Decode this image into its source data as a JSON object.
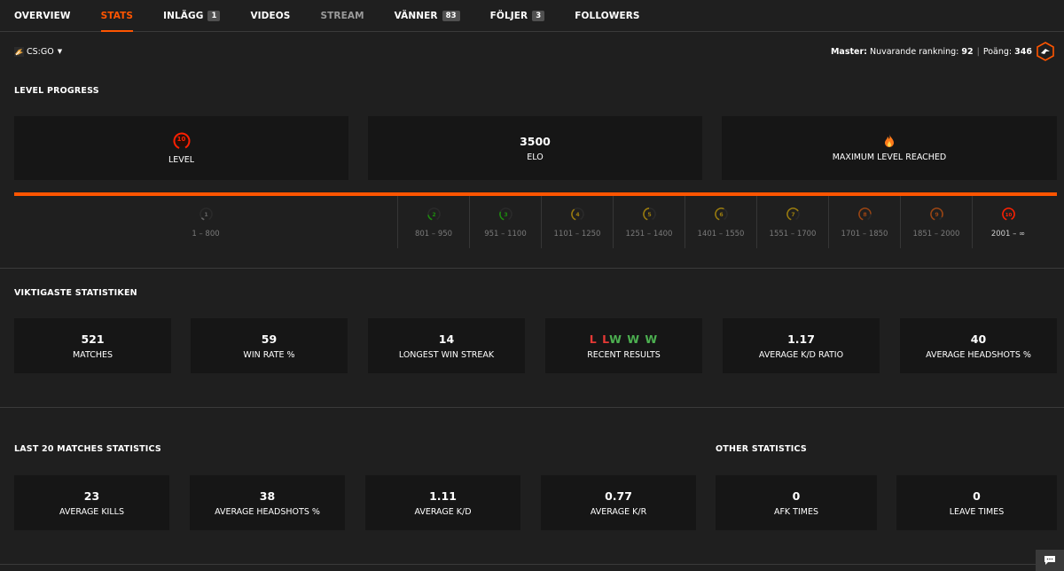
{
  "nav": {
    "tabs": [
      {
        "label": "OVERVIEW",
        "state": "normal"
      },
      {
        "label": "STATS",
        "state": "active"
      },
      {
        "label": "INLÄGG",
        "badge": "1",
        "state": "normal"
      },
      {
        "label": "VIDEOS",
        "state": "normal"
      },
      {
        "label": "STREAM",
        "state": "dim"
      },
      {
        "label": "VÄNNER",
        "badge": "83",
        "state": "normal"
      },
      {
        "label": "FÖLJER",
        "badge": "3",
        "state": "normal"
      },
      {
        "label": "FOLLOWERS",
        "state": "normal"
      }
    ]
  },
  "game": {
    "name": "CS:GO"
  },
  "ranking": {
    "label": "Master:",
    "rank_label": "Nuvarande rankning:",
    "rank_value": "92",
    "points_label": "Poäng:",
    "points_value": "346"
  },
  "level_progress": {
    "title": "LEVEL PROGRESS",
    "level": {
      "value": "10",
      "label": "LEVEL"
    },
    "elo": {
      "value": "3500",
      "label": "ELO"
    },
    "max": {
      "label": "MAXIMUM LEVEL REACHED"
    },
    "progress_fraction": 1.0,
    "levels": [
      {
        "n": "1",
        "range": "1 – 800",
        "color": "#9e9e9e"
      },
      {
        "n": "2",
        "range": "801 – 950",
        "color": "#1ce400"
      },
      {
        "n": "3",
        "range": "951 – 1100",
        "color": "#1ce400"
      },
      {
        "n": "4",
        "range": "1101 – 1250",
        "color": "#ffc800"
      },
      {
        "n": "5",
        "range": "1251 – 1400",
        "color": "#ffc800"
      },
      {
        "n": "6",
        "range": "1401 – 1550",
        "color": "#ffc800"
      },
      {
        "n": "7",
        "range": "1551 – 1700",
        "color": "#ffc800"
      },
      {
        "n": "8",
        "range": "1701 – 1850",
        "color": "#ff6309"
      },
      {
        "n": "9",
        "range": "1851 – 2000",
        "color": "#ff6309"
      },
      {
        "n": "10",
        "range": "2001 – ∞",
        "color": "#fe1f00"
      }
    ]
  },
  "key_stats": {
    "title": "VIKTIGASTE STATISTIKEN",
    "items": [
      {
        "value": "521",
        "label": "MATCHES"
      },
      {
        "value": "59",
        "label": "WIN RATE %"
      },
      {
        "value": "14",
        "label": "LONGEST WIN STREAK"
      },
      {
        "value": "",
        "label": "RECENT RESULTS"
      },
      {
        "value": "1.17",
        "label": "AVERAGE K/D RATIO"
      },
      {
        "value": "40",
        "label": "AVERAGE HEADSHOTS %"
      }
    ],
    "recent_results": [
      "L",
      "L",
      "W",
      "W",
      "W"
    ]
  },
  "last20": {
    "title": "LAST 20 MATCHES STATISTICS",
    "items": [
      {
        "value": "23",
        "label": "AVERAGE KILLS"
      },
      {
        "value": "38",
        "label": "AVERAGE HEADSHOTS %"
      },
      {
        "value": "1.11",
        "label": "AVERAGE K/D"
      },
      {
        "value": "0.77",
        "label": "AVERAGE K/R"
      }
    ]
  },
  "other": {
    "title": "OTHER STATISTICS",
    "items": [
      {
        "value": "0",
        "label": "AFK TIMES"
      },
      {
        "value": "0",
        "label": "LEAVE TIMES"
      }
    ]
  },
  "colors": {
    "accent": "#ff5500",
    "card_bg": "#161616",
    "page_bg": "#1f1f1f",
    "win": "#4caf50",
    "loss": "#e53935"
  }
}
